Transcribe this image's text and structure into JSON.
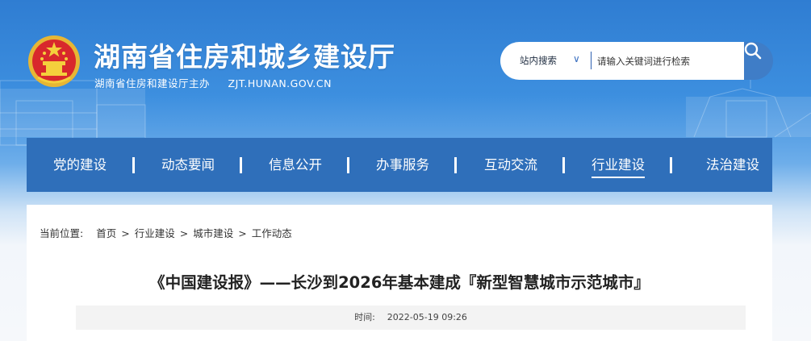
{
  "header": {
    "title": "湖南省住房和城乡建设厅",
    "sponsor": "湖南省住房和建设厅主办",
    "domain": "ZJT.HUNAN.GOV.CN"
  },
  "search": {
    "scope_label": "站内搜索",
    "placeholder": "请输入关键词进行检索"
  },
  "nav": {
    "items": [
      {
        "label": "党的建设"
      },
      {
        "label": "动态要闻"
      },
      {
        "label": "信息公开"
      },
      {
        "label": "办事服务"
      },
      {
        "label": "互动交流"
      },
      {
        "label": "行业建设",
        "active": true
      },
      {
        "label": "法治建设"
      }
    ]
  },
  "breadcrumb": {
    "prefix": "当前位置:",
    "items": [
      "首页",
      "行业建设",
      "城市建设",
      "工作动态"
    ],
    "separator": ">"
  },
  "article": {
    "title": "《中国建设报》——长沙到2026年基本建成『新型智慧城市示范城市』",
    "time_label": "时间:",
    "time_value": "2022-05-19 09:26"
  },
  "colors": {
    "nav_bg": "#2f6fba",
    "search_button": "#3f7dc7",
    "header_blue": "#2f7dd2"
  }
}
